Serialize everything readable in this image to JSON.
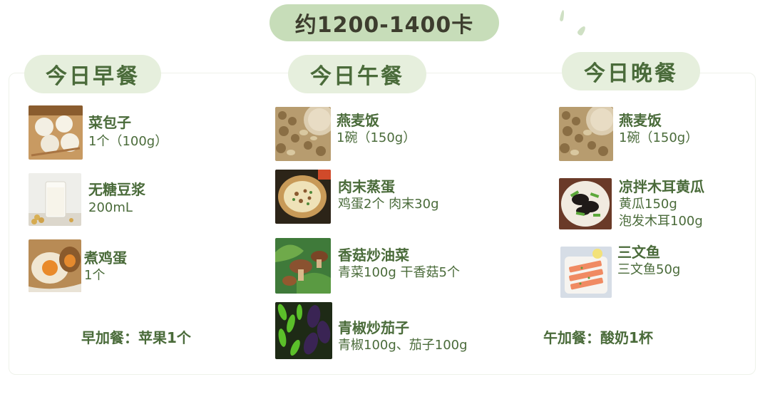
{
  "calories": "约1200-1400卡",
  "breakfast": {
    "title": "今日早餐",
    "items": [
      {
        "name": "菜包子",
        "qty": "1个（100g）",
        "image": "steamed-buns"
      },
      {
        "name": "无糖豆浆",
        "qty": "200mL",
        "image": "soy-milk"
      },
      {
        "name": "煮鸡蛋",
        "qty": "1个",
        "image": "boiled-egg"
      }
    ],
    "snack": "早加餐：苹果1个"
  },
  "lunch": {
    "title": "今日午餐",
    "items": [
      {
        "name": "燕麦饭",
        "qty": "1碗（150g）",
        "image": "oat-rice"
      },
      {
        "name": "肉末蒸蛋",
        "qty": "鸡蛋2个 肉末30g",
        "image": "steamed-egg"
      },
      {
        "name": "香菇炒油菜",
        "qty": "青菜100g 干香菇5个",
        "image": "mushroom-greens"
      },
      {
        "name": "青椒炒茄子",
        "qty": "青椒100g、茄子100g",
        "image": "pepper-eggplant"
      }
    ]
  },
  "dinner": {
    "title": "今日晚餐",
    "items": [
      {
        "name": "燕麦饭",
        "qty": "1碗（150g）",
        "image": "oat-rice"
      },
      {
        "name": "凉拌木耳黄瓜",
        "qty1": "黄瓜150g",
        "qty2": "泡发木耳100g",
        "image": "fungus-cucumber"
      },
      {
        "name": "三文鱼",
        "qty": "三文鱼50g",
        "image": "salmon"
      }
    ],
    "snack": "午加餐：酸奶1杯"
  },
  "colors": {
    "accent": "#c7ddb9",
    "header_bg": "#e6efdd",
    "text": "#4a6b3a"
  }
}
